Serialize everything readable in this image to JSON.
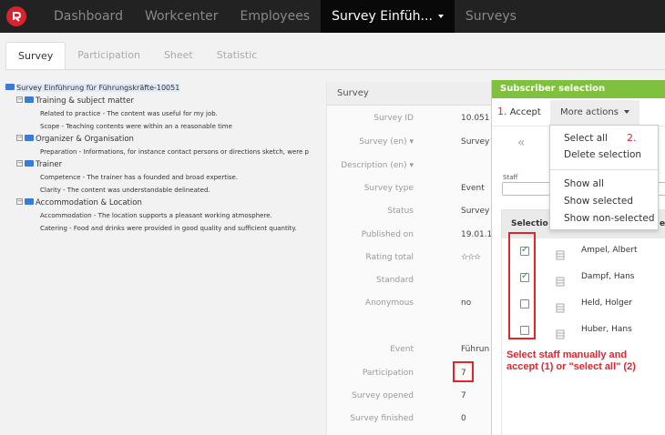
{
  "nav": {
    "items": [
      "Dashboard",
      "Workcenter",
      "Employees",
      "Survey Einfüh...",
      "Surveys"
    ],
    "active_index": 3
  },
  "tabs": [
    "Survey",
    "Participation",
    "Sheet",
    "Statistic"
  ],
  "tree": {
    "root": "Survey Einführung für Führungskräfte-10051",
    "groups": [
      {
        "label": "Training & subject matter",
        "items": [
          "Related to practice - The content was useful for my job.",
          "Scope - Teaching contents were within an a reasonable time"
        ]
      },
      {
        "label": "Organizer & Organisation",
        "items": [
          "Preparation - Informations, for instance contact persons or directions sketch, were p"
        ]
      },
      {
        "label": "Trainer",
        "items": [
          "Competence - The trainer has a founded and broad expertise.",
          "Clarity - The content was understandable delineated."
        ]
      },
      {
        "label": "Accommodation & Location",
        "items": [
          "Accommodation - The location supports a pleasant working atmosphere.",
          "Catering - Food and drinks were provided in good quality and sufficient quantity."
        ]
      }
    ]
  },
  "survey_panel": {
    "header": "Survey",
    "props": [
      {
        "k": "Survey ID",
        "v": "10.051"
      },
      {
        "k": "Survey (en) ▾",
        "v": "Survey"
      },
      {
        "k": "Description (en) ▾",
        "v": ""
      },
      {
        "k": "Survey type",
        "v": "Event"
      },
      {
        "k": "Status",
        "v": "Survey"
      },
      {
        "k": "Published on",
        "v": "19.01.1"
      },
      {
        "k": "Rating total",
        "v": "☆☆☆"
      },
      {
        "k": "Standard",
        "v": ""
      },
      {
        "k": "Anonymous",
        "v": "no"
      },
      {
        "k": "Event",
        "v": "Führun"
      },
      {
        "k": "Participation",
        "v": "7"
      },
      {
        "k": "Survey opened",
        "v": "7"
      },
      {
        "k": "Survey finished",
        "v": "0"
      }
    ]
  },
  "dialog": {
    "title": "Subscriber selection",
    "accept_num": "1.",
    "accept_label": "Accept",
    "more_actions_label": "More actions",
    "prev_glyph": "«",
    "staff_label": "Staff",
    "column_header": "Selectio",
    "column_header_tail": "e",
    "rows": [
      {
        "name": "Ampel, Albert",
        "checked": true
      },
      {
        "name": "Dampf, Hans",
        "checked": true
      },
      {
        "name": "Held, Holger",
        "checked": false
      },
      {
        "name": "Huber, Hans",
        "checked": false
      }
    ]
  },
  "menu": {
    "select_all": "Select all",
    "select_all_num": "2.",
    "delete_selection": "Delete selection",
    "show_all": "Show all",
    "show_selected": "Show selected",
    "show_non_selected": "Show non-selected"
  },
  "annotation": "Select staff manually and\naccept (1) or \"select all\" (2)",
  "colors": {
    "accent": "#7fc13e",
    "highlight": "#e3242b",
    "nav": "#222222",
    "folder": "#3a7bd5"
  }
}
